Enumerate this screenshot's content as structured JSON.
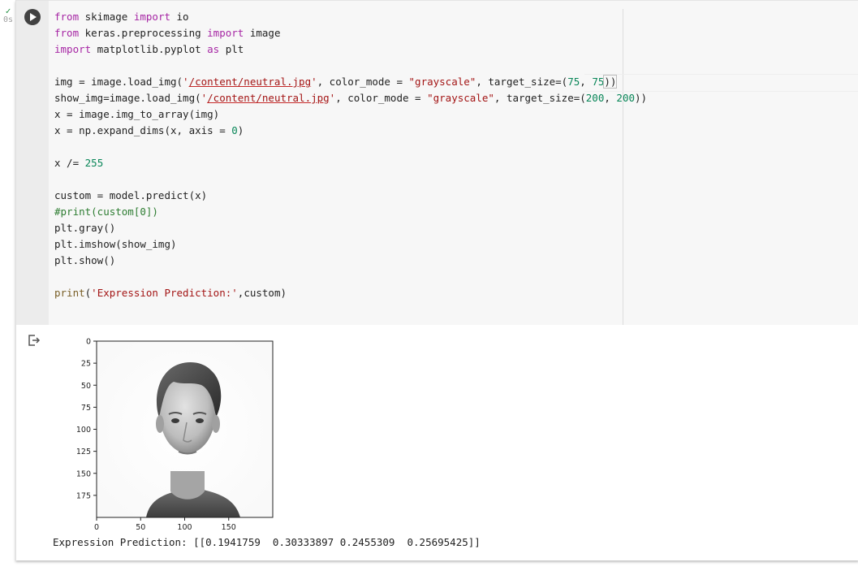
{
  "cell": {
    "status_mark": "✓",
    "exec_time": "0s",
    "run_icon": "play-icon"
  },
  "code": {
    "line1": {
      "kw_from": "from",
      "mod": " skimage ",
      "kw_import": "import",
      "rest": " io"
    },
    "line2": {
      "kw_from": "from",
      "mod": " keras.preprocessing ",
      "kw_import": "import",
      "rest": " image"
    },
    "line3": {
      "kw_import": "import",
      "mod": " matplotlib.pyplot ",
      "kw_as": "as",
      "rest": " plt"
    },
    "line5": {
      "pre": "img = image.load_img(",
      "q1": "'",
      "path": "/content/neutral.jpg",
      "q2": "'",
      "mid": ", color_mode = ",
      "mode": "\"grayscale\"",
      "ts": ", target_size=(",
      "n1": "75",
      "sep": ", ",
      "n2": "75",
      "end": "))"
    },
    "line6": {
      "pre": "show_img=image.load_img(",
      "q1": "'",
      "path": "/content/neutral.jpg",
      "q2": "'",
      "mid": ", color_mode = ",
      "mode": "\"grayscale\"",
      "ts": ", target_size=(",
      "n1": "200",
      "sep": ", ",
      "n2": "200",
      "end": "))"
    },
    "line7": "x = image.img_to_array(img)",
    "line8": {
      "pre": "x = np.expand_dims(x, axis = ",
      "num": "0",
      "end": ")"
    },
    "line10": {
      "pre": "x /= ",
      "num": "255"
    },
    "line12": "custom = model.predict(x)",
    "line13": "#print(custom[0])",
    "line14": "plt.gray()",
    "line15": "plt.imshow(show_img)",
    "line16": "plt.show()",
    "line18": {
      "fn": "print",
      "open": "(",
      "str": "'Expression Prediction:'",
      "rest": ",custom)"
    }
  },
  "output": {
    "icon": "output-redirect-icon",
    "text": "Expression Prediction: [[0.1941759  0.30333897 0.2455309  0.25695425]]"
  },
  "chart_data": {
    "type": "image",
    "xlim": [
      0,
      200
    ],
    "ylim": [
      200,
      0
    ],
    "xticks": [
      0,
      50,
      100,
      150
    ],
    "yticks": [
      0,
      25,
      50,
      75,
      100,
      125,
      150,
      175
    ],
    "grid": false,
    "colormap": "gray"
  }
}
